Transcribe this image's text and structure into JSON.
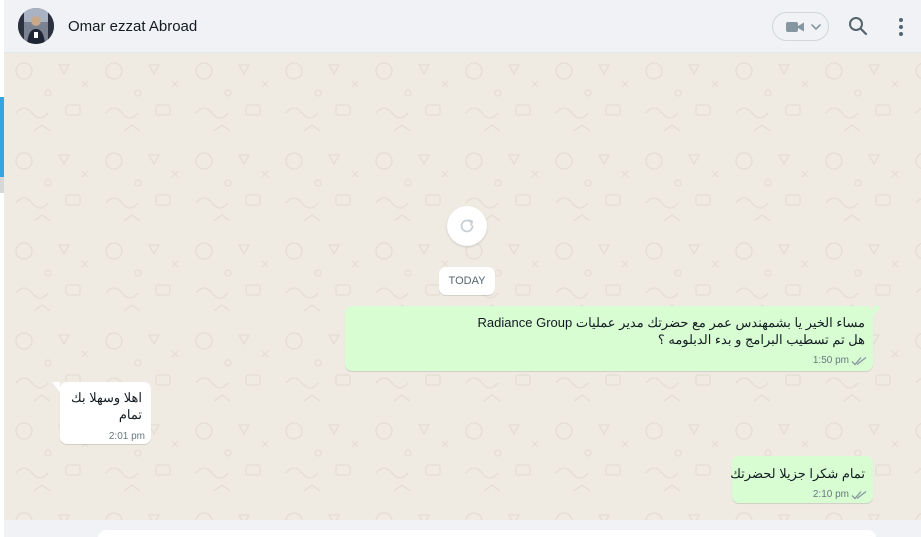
{
  "header": {
    "contact_name": "Omar ezzat Abroad",
    "avatar_icon": "avatar-photo",
    "video_icon": "video-camera-icon",
    "search_icon": "search-icon",
    "menu_icon": "vertical-dots-icon"
  },
  "chat": {
    "refresh_icon": "refresh-icon",
    "date_divider": "TODAY",
    "messages": [
      {
        "direction": "outgoing",
        "lines": [
          "مساء الخير يا بشمهندس عمر مع حضرتك  مدير عمليات Radiance Group",
          "هل تم تسطيب البرامج و بدء الدبلومه ؟"
        ],
        "time": "1:50 pm",
        "status_icon": "double-check-icon"
      },
      {
        "direction": "incoming",
        "lines": [
          "اهلا وسهلا بك",
          "تمام"
        ],
        "time": "2:01 pm"
      },
      {
        "direction": "outgoing",
        "lines": [
          "تمام شكرا جزيلا لحضرتك"
        ],
        "time": "2:10 pm",
        "status_icon": "double-check-icon"
      }
    ]
  },
  "colors": {
    "outgoing_bubble": "#d9fdd3",
    "incoming_bubble": "#ffffff",
    "chat_background": "#efeae2",
    "header_background": "#f0f2f5",
    "tick_color": "#8696a0"
  }
}
